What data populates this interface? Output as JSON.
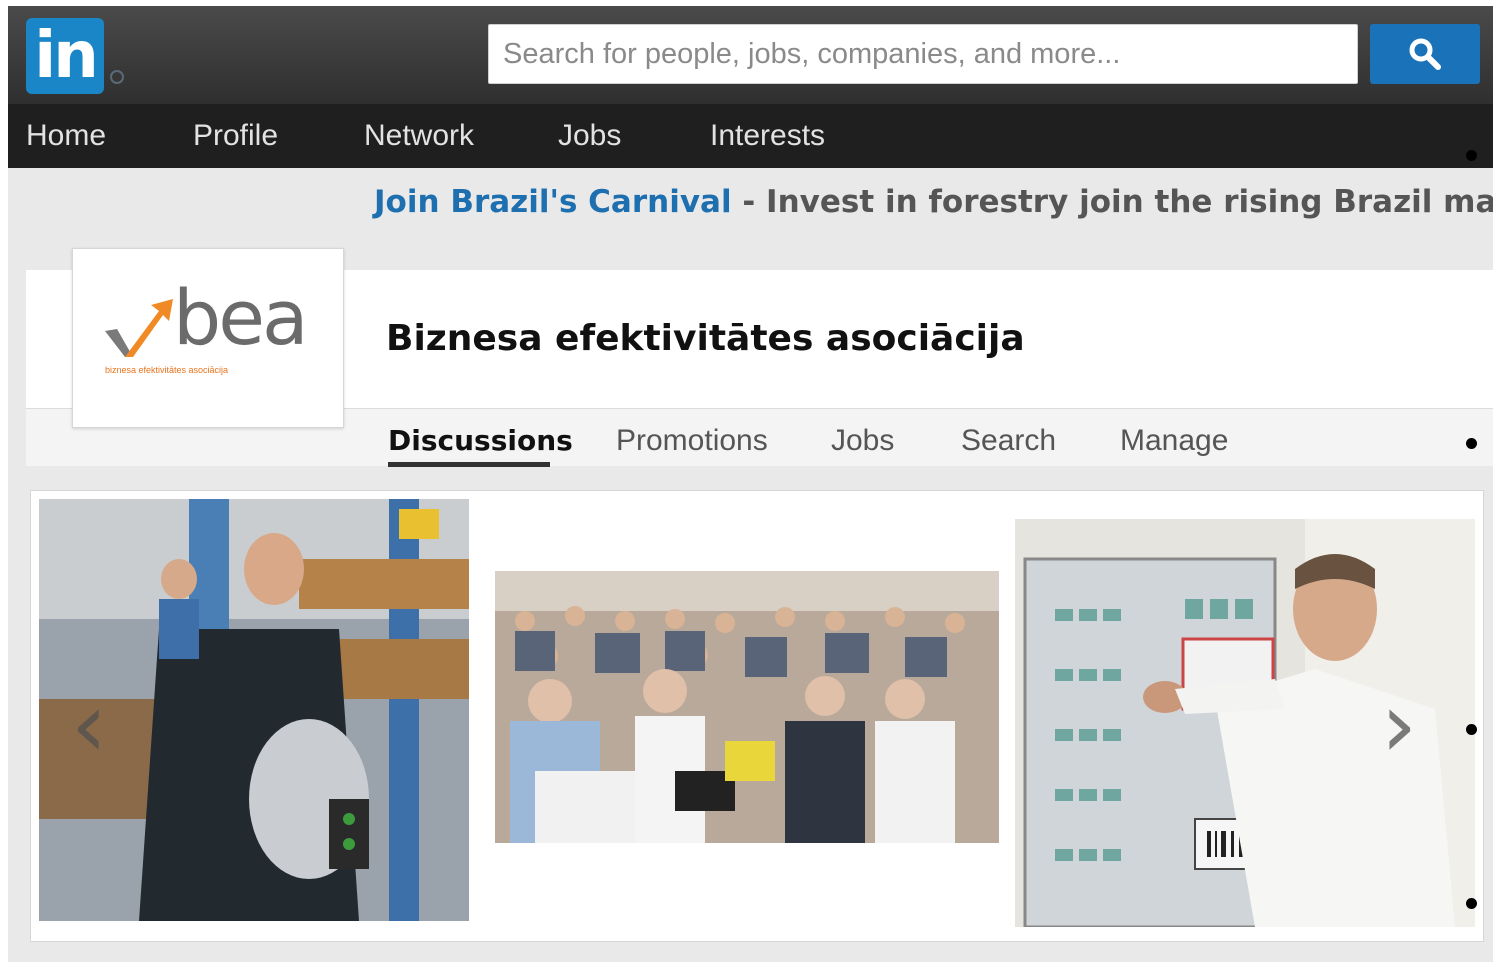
{
  "header": {
    "logo_text": "in",
    "search_placeholder": "Search for people, jobs, companies, and more..."
  },
  "nav": {
    "items": [
      "Home",
      "Profile",
      "Network",
      "Jobs",
      "Interests"
    ]
  },
  "ad": {
    "link": "Join Brazil's Carnival",
    "separator": " - ",
    "text": "Invest in forestry join the rising Brazil market. Re"
  },
  "group": {
    "logo_text": "bea",
    "logo_subtitle": "biznesa efektivitātes asociācija",
    "title": "Biznesa efektivitātes asociācija",
    "tabs": [
      "Discussions",
      "Promotions",
      "Jobs",
      "Search",
      "Manage"
    ],
    "active_tab": "Discussions"
  },
  "gallery": {
    "photos": [
      "factory-worker-photo",
      "conference-audience-photo",
      "presenter-photo"
    ]
  },
  "colors": {
    "brand_blue": "#1a86c8",
    "search_button": "#1a73b8",
    "ad_link": "#1d6fb0",
    "logo_orange": "#f08a24"
  }
}
